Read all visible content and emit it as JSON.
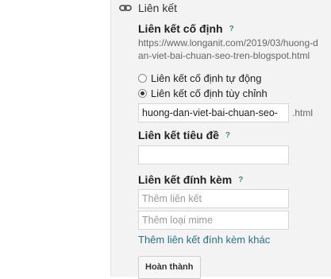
{
  "section": {
    "title": "Liên kết"
  },
  "permalink": {
    "label": "Liên kết cố định",
    "help": "?",
    "url": "https://www.longanit.com/2019/03/huong-dan-viet-bai-chuan-seo-tren-blogspot.html",
    "options": [
      "Liên kết cố định tự động",
      "Liên kết cố định tùy chỉnh"
    ],
    "selected": "Liên kết cố định tùy chỉnh",
    "slug": "huong-dan-viet-bai-chuan-seo-",
    "suffix": ".html"
  },
  "title_link": {
    "label": "Liên kết tiêu đề",
    "help": "?",
    "value": ""
  },
  "attachments": {
    "label": "Liên kết đính kèm",
    "help": "?",
    "link_placeholder": "Thêm liên kết",
    "mime_placeholder": "Thêm loại mime",
    "add_more": "Thêm liên kết đính kèm khác"
  },
  "done_button": "Hoàn thành"
}
